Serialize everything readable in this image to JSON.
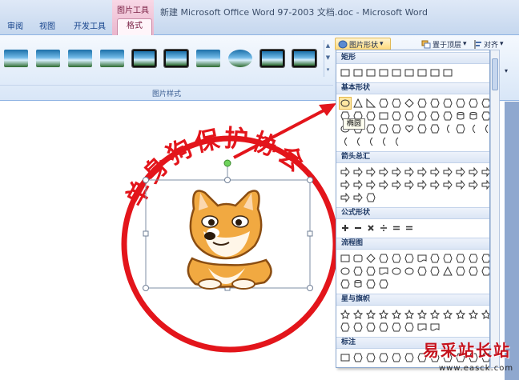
{
  "window": {
    "title": "新建 Microsoft Office Word 97-2003 文档.doc - Microsoft Word",
    "context_tool_label": "图片工具"
  },
  "tabs": {
    "review": "审阅",
    "view": "视图",
    "developer": "开发工具",
    "format": "格式"
  },
  "ribbon": {
    "picture_shape_button": "图片形状",
    "bring_to_front_button": "置于顶层",
    "align_button": "对齐",
    "styles_group_label": "图片样式",
    "styles_gallery": [
      "soft-edge",
      "soft-edge",
      "soft-edge",
      "soft-edge",
      "black-frame",
      "black-frame",
      "plain",
      "oval",
      "black-frame",
      "black-frame"
    ]
  },
  "shape_menu": {
    "sections": [
      {
        "heading": "矩形",
        "rows": [
          [
            "rect",
            "rect",
            "rect",
            "rect",
            "rect",
            "rect",
            "rect",
            "rect",
            "rect"
          ]
        ]
      },
      {
        "heading": "基本形状",
        "rows": [
          [
            "oval",
            "triangle",
            "right-triangle",
            "parallelogram",
            "trapezoid",
            "diamond",
            "pentagon",
            "hexagon",
            "heptagon",
            "octagon",
            "decagon",
            "dodecagon"
          ],
          [
            "pie",
            "chord",
            "teardrop",
            "frame",
            "half-frame",
            "l-shape",
            "diag-stripe",
            "cross",
            "plaque",
            "can",
            "cube",
            "bevel"
          ],
          [
            "donut",
            "no-symbol",
            "block-arc",
            "folded-corner",
            "smiley",
            "heart",
            "lightning",
            "sun",
            "moon",
            "cloud",
            "arc",
            "bracket-pair"
          ],
          [
            "brace-pair",
            "left-bracket",
            "right-bracket",
            "left-brace",
            "right-brace"
          ]
        ]
      },
      {
        "heading": "箭头总汇",
        "rows": [
          [
            "arrow-right",
            "arrow-left",
            "arrow-up",
            "arrow-down",
            "arrow-lr",
            "arrow-ud",
            "arrow-quad",
            "arrow-lru",
            "arrow-bent",
            "arrow-u-turn",
            "arrow-left-up",
            "arrow-bent-up"
          ],
          [
            "arrow-curved-r",
            "arrow-curved-l",
            "arrow-curved-u",
            "arrow-curved-d",
            "arrow-striped",
            "arrow-notched",
            "arrow-pentagon",
            "arrow-chevron",
            "callout-right",
            "callout-down",
            "callout-left",
            "callout-up"
          ],
          [
            "callout-lr",
            "callout-quad",
            "circular-arrow"
          ]
        ]
      },
      {
        "heading": "公式形状",
        "rows": [
          [
            "plus",
            "minus",
            "multiply",
            "divide",
            "equal",
            "not-equal"
          ]
        ]
      },
      {
        "heading": "流程图",
        "rows": [
          [
            "process",
            "alt-process",
            "decision",
            "data",
            "predefined",
            "internal",
            "document",
            "multidoc",
            "terminator",
            "preparation",
            "manual-input",
            "manual-op"
          ],
          [
            "connector",
            "offpage",
            "card",
            "punched-tape",
            "summing",
            "or",
            "collate",
            "sort",
            "extract",
            "merge",
            "stored-data",
            "delay"
          ],
          [
            "seq-access",
            "magnetic-disk",
            "direct-access",
            "display"
          ]
        ]
      },
      {
        "heading": "星与旗帜",
        "rows": [
          [
            "explosion1",
            "explosion2",
            "star4",
            "star5",
            "star6",
            "star7",
            "star8",
            "star10",
            "star12",
            "star16",
            "star24",
            "star32"
          ],
          [
            "ribbon-up",
            "ribbon-down",
            "curved-up",
            "curved-down",
            "scroll-v",
            "scroll-h",
            "wave",
            "double-wave"
          ]
        ]
      },
      {
        "heading": "标注",
        "rows": [
          [
            "rect-callout",
            "round-callout",
            "oval-callout",
            "cloud-callout",
            "line-callout1",
            "line-callout2",
            "line-callout3",
            "line-callout4",
            "line-callout5",
            "line-callout6",
            "line-callout7",
            "line-callout8"
          ]
        ]
      }
    ],
    "tooltip": "椭圆"
  },
  "document": {
    "seal_text": "单身狗保护协会"
  },
  "watermark": {
    "logo_text": "易采站长站",
    "url": "www.easck.com"
  },
  "colors": {
    "seal_red": "#e3151b",
    "arrow_red": "#e3151b",
    "ribbon_blue": "#dbe7f6",
    "context_pink": "#f3c4d8"
  }
}
